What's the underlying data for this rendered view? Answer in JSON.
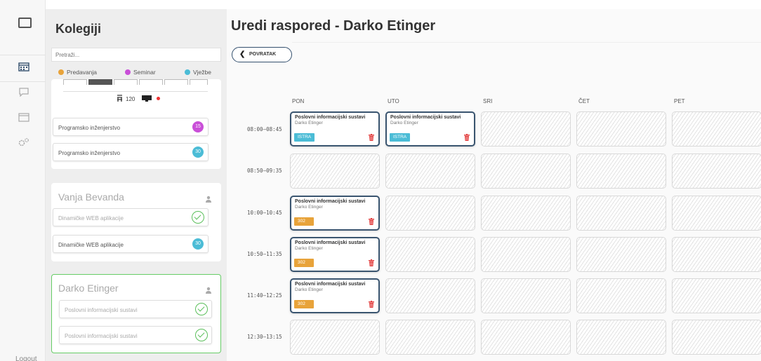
{
  "rail": {
    "logout": "Logout"
  },
  "courses": {
    "title": "Kolegiji",
    "search_placeholder": "Pretraži...",
    "legend": [
      {
        "label": "Predavanja",
        "color": "#e8a33a"
      },
      {
        "label": "Seminar",
        "color": "#c94fd8"
      },
      {
        "label": "Vježbe",
        "color": "#4bbcd6"
      }
    ],
    "top_group": {
      "capacity": "120",
      "items": [
        {
          "label": "Programsko inženjerstvo",
          "badge": "15",
          "color": "#c94fd8"
        },
        {
          "label": "Programsko inženjerstvo",
          "badge": "30",
          "color": "#4bbcd6"
        }
      ]
    },
    "professors": [
      {
        "name": "Vanja Bevanda",
        "items": [
          {
            "label": "Dinamičke WEB aplikacije",
            "state": "done"
          },
          {
            "label": "Dinamičke WEB aplikacije",
            "badge": "30",
            "color": "#4bbcd6"
          }
        ]
      },
      {
        "name": "Darko Etinger",
        "items": [
          {
            "label": "Poslovni informacijski sustavi",
            "state": "done"
          },
          {
            "label": "Poslovni informacijski sustavi",
            "state": "done"
          }
        ]
      }
    ]
  },
  "schedule": {
    "title": "Uredi raspored - Darko Etinger",
    "back_label": "POVRATAK",
    "days": [
      "PON",
      "UTO",
      "SRI",
      "ČET",
      "PET"
    ],
    "times": [
      "08:00–08:45",
      "08:50–09:35",
      "10:00–10:45",
      "10:50–11:35",
      "11:40–12:25",
      "12:30–13:15"
    ],
    "events": [
      {
        "day": 0,
        "slot": 0,
        "title": "Poslovni informacijski sustavi",
        "teacher": "Darko Etinger",
        "room": "ISTRA",
        "room_color": "#4bbcd6"
      },
      {
        "day": 1,
        "slot": 0,
        "title": "Poslovni informacijski sustavi",
        "teacher": "Darko Etinger",
        "room": "ISTRA",
        "room_color": "#4bbcd6"
      },
      {
        "day": 0,
        "slot": 2,
        "title": "Poslovni informacijski sustavi",
        "teacher": "Darko Etinger",
        "room": "302",
        "room_color": "#e8a33a"
      },
      {
        "day": 0,
        "slot": 3,
        "title": "Poslovni informacijski sustavi",
        "teacher": "Darko Etinger",
        "room": "302",
        "room_color": "#e8a33a"
      },
      {
        "day": 0,
        "slot": 4,
        "title": "Poslovni informacijski sustavi",
        "teacher": "Darko Etinger",
        "room": "302",
        "room_color": "#e8a33a"
      }
    ]
  }
}
